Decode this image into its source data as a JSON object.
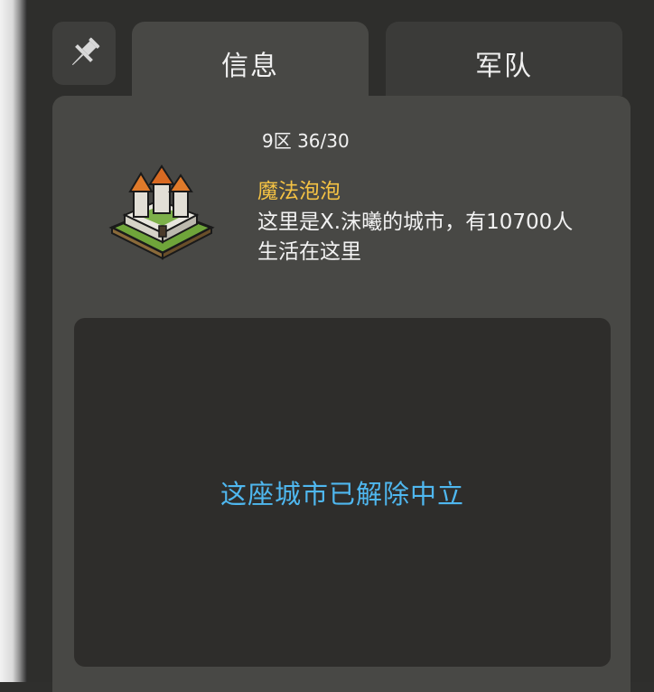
{
  "tabs": {
    "info_label": "信息",
    "army_label": "军队"
  },
  "city": {
    "coords": "9区 36/30",
    "name": "魔法泡泡",
    "description": "这里是X.沫曦的城市，有10700人生活在这里",
    "status": "这座城市已解除中立"
  },
  "colors": {
    "name": "#f4c244",
    "status": "#4fb7ef"
  },
  "icons": {
    "pin": "pin-icon",
    "city": "castle-icon"
  }
}
